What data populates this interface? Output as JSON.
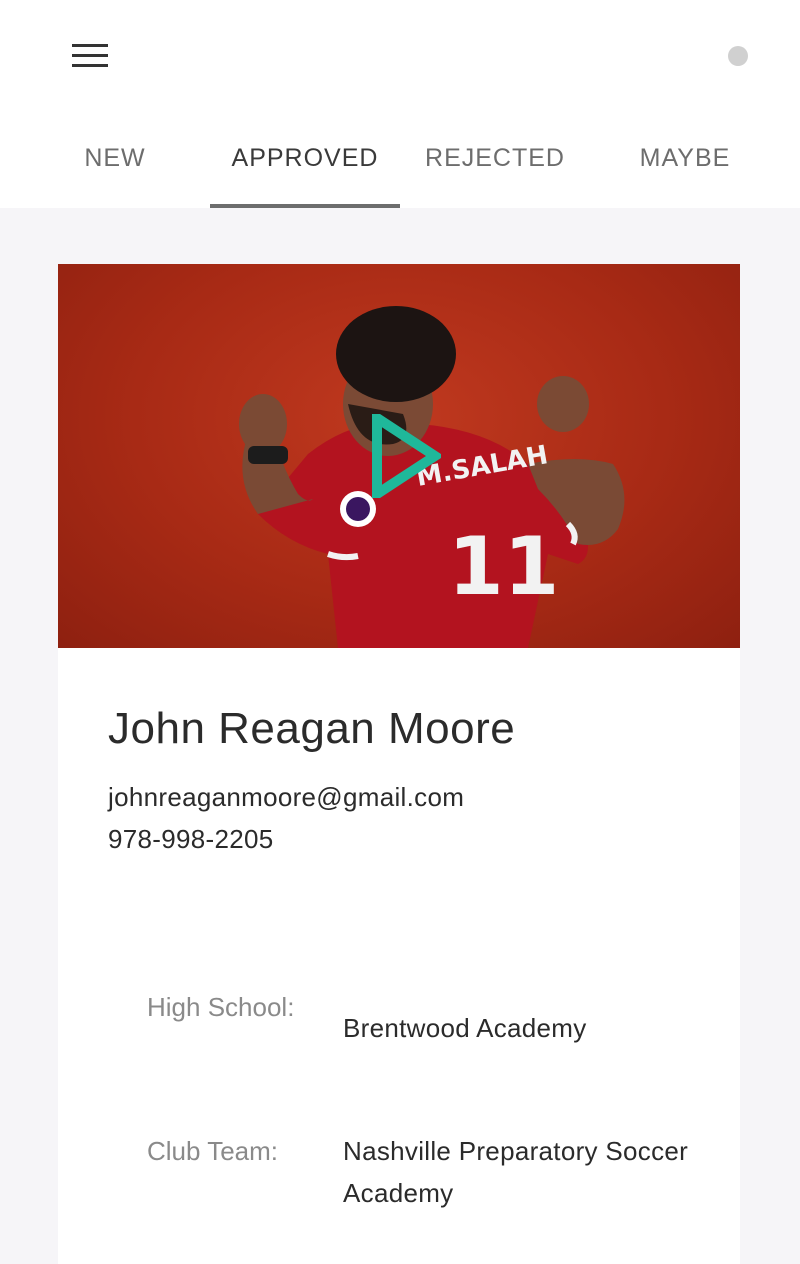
{
  "header": {
    "menu_icon": "hamburger-menu-icon",
    "status_indicator": "status-dot-icon",
    "status_color": "#d0d0d0"
  },
  "tabs": [
    {
      "label": "NEW",
      "active": false
    },
    {
      "label": "APPROVED",
      "active": true
    },
    {
      "label": "REJECTED",
      "active": false
    },
    {
      "label": "MAYBE",
      "active": false
    }
  ],
  "profile": {
    "video_icon": "play-icon",
    "accent_color": "#1fb89a",
    "name": "John Reagan Moore",
    "email": "johnreaganmoore@gmail.com",
    "phone": "978-998-2205",
    "details": [
      {
        "label": "High School:",
        "value": "Brentwood Academy"
      },
      {
        "label": "Club Team:",
        "value": "Nashville Preparatory Soccer Academy"
      }
    ]
  }
}
